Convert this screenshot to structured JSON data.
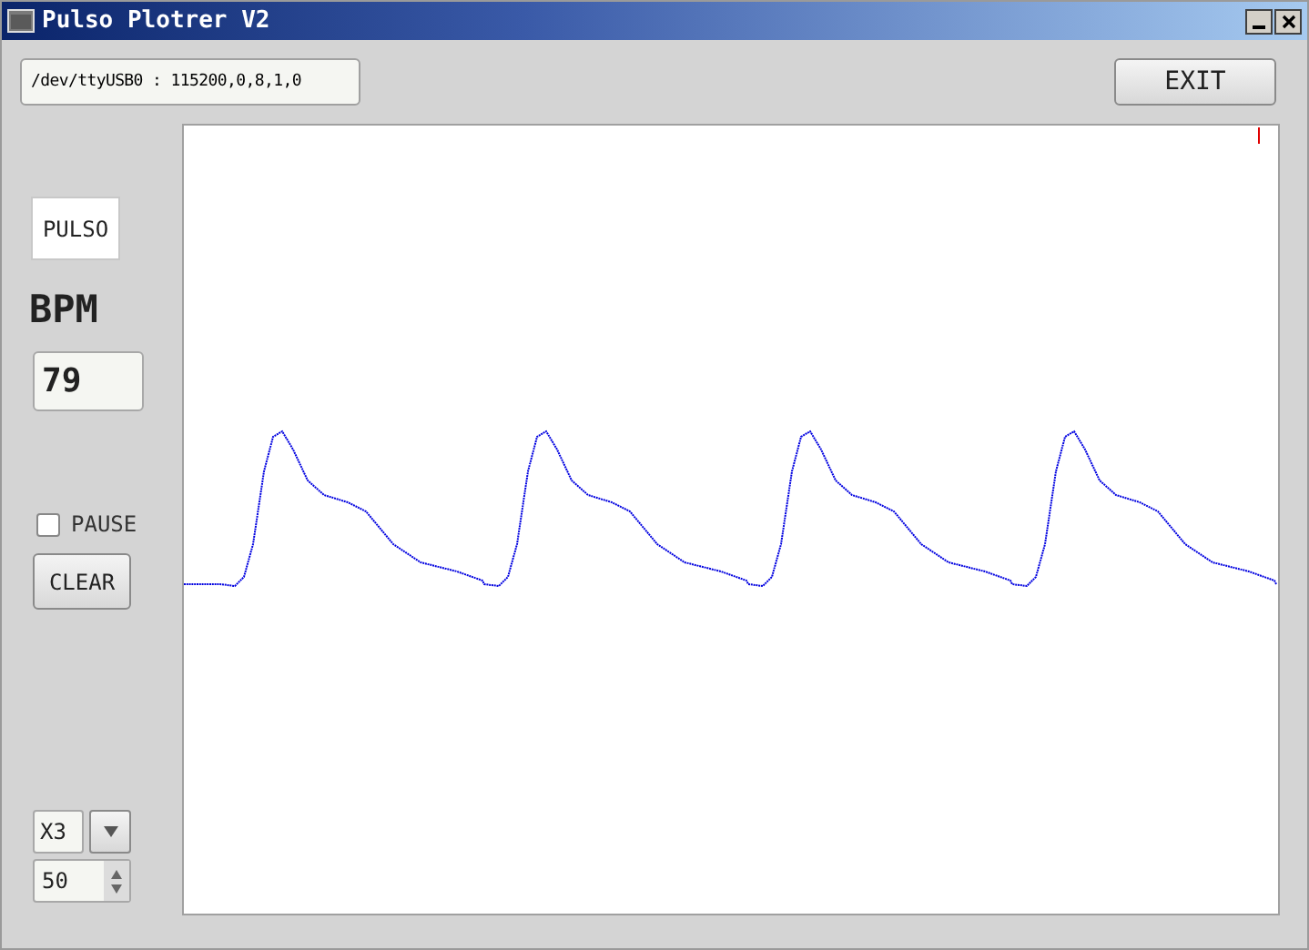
{
  "window": {
    "title": "Pulso Plotrer V2"
  },
  "port": {
    "value": "/dev/ttyUSB0 : 115200,0,8,1,0"
  },
  "exit_button": "EXIT",
  "pulse_label": "PULSO",
  "bpm": {
    "label": "BPM",
    "value": "79"
  },
  "pause": {
    "label": "PAUSE",
    "checked": false
  },
  "clear_button": "CLEAR",
  "scale_combo": {
    "value": "X3"
  },
  "spin": {
    "value": "50"
  }
}
